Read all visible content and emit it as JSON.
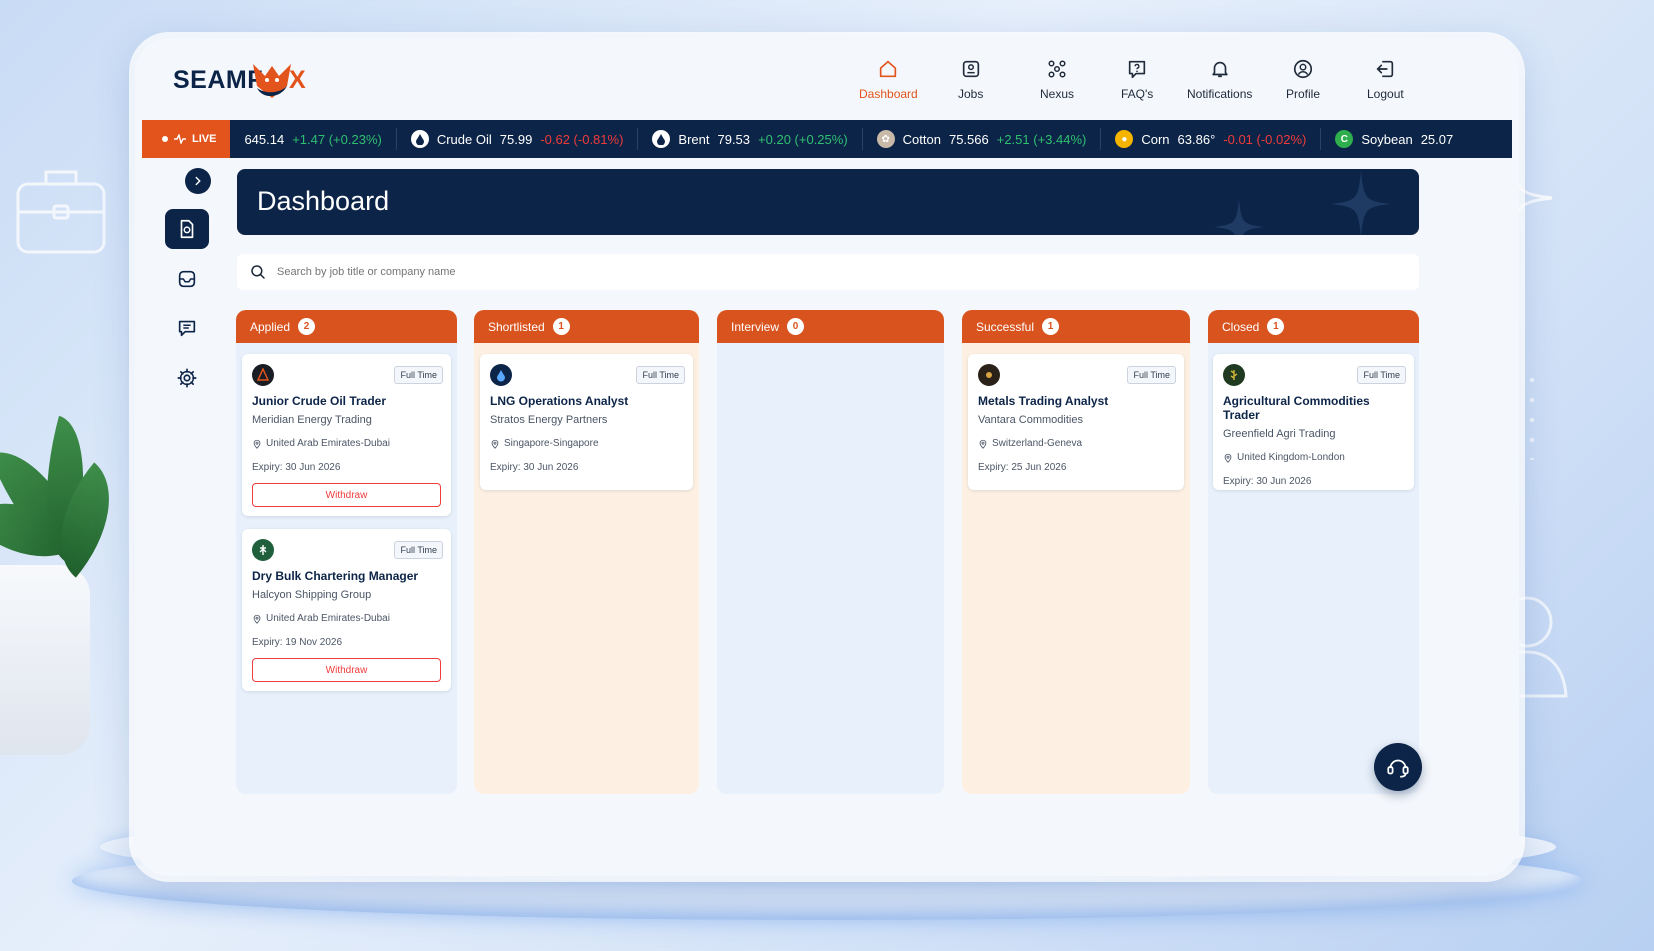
{
  "app": {
    "logo_left": "SEAMF",
    "logo_right": "X"
  },
  "nav": [
    {
      "label": "Dashboard",
      "icon": "home-icon",
      "active": true
    },
    {
      "label": "Jobs",
      "icon": "jobs-icon"
    },
    {
      "label": "Nexus",
      "icon": "network-icon"
    },
    {
      "label": "FAQ's",
      "icon": "faq-icon"
    },
    {
      "label": "Notifications",
      "icon": "bell-icon"
    },
    {
      "label": "Profile",
      "icon": "profile-icon"
    },
    {
      "label": "Logout",
      "icon": "logout-icon"
    }
  ],
  "ticker": {
    "live_label": "LIVE",
    "items": [
      {
        "name": "",
        "price": "645.14",
        "change": "+1.47 (+0.23%)",
        "direction": "up"
      },
      {
        "name": "Crude Oil",
        "price": "75.99",
        "change": "-0.62 (-0.81%)",
        "direction": "down",
        "icon": "oil-drop-icon"
      },
      {
        "name": "Brent",
        "price": "79.53",
        "change": "+0.20 (+0.25%)",
        "direction": "up",
        "icon": "oil-drop-icon"
      },
      {
        "name": "Cotton",
        "price": "75.566",
        "change": "+2.51 (+3.44%)",
        "direction": "up",
        "icon": "cotton-icon"
      },
      {
        "name": "Corn",
        "price": "63.86°",
        "change": "-0.01 (-0.02%)",
        "direction": "down",
        "icon": "corn-icon"
      },
      {
        "name": "Soybean",
        "price": "25.07",
        "change": "",
        "direction": "up",
        "icon": "soybean-icon"
      }
    ]
  },
  "page": {
    "title": "Dashboard"
  },
  "search": {
    "placeholder": "Search by job title or company name"
  },
  "columns": [
    {
      "label": "Applied",
      "count": "2",
      "cards": [
        {
          "title": "Junior Crude Oil Trader",
          "company": "Meridian Energy Trading",
          "location": "United Arab Emirates-Dubai",
          "expiry": "Expiry: 30 Jun 2026",
          "type": "Full Time",
          "action": "Withdraw"
        },
        {
          "title": "Dry Bulk Chartering Manager",
          "company": "Halcyon Shipping Group",
          "location": "United Arab Emirates-Dubai",
          "expiry": "Expiry: 19 Nov 2026",
          "type": "Full Time",
          "action": "Withdraw"
        }
      ]
    },
    {
      "label": "Shortlisted",
      "count": "1",
      "cards": [
        {
          "title": "LNG Operations Analyst",
          "company": "Stratos Energy Partners",
          "location": "Singapore-Singapore",
          "expiry": "Expiry: 30 Jun 2026",
          "type": "Full Time"
        }
      ]
    },
    {
      "label": "Interview",
      "count": "0",
      "cards": []
    },
    {
      "label": "Successful",
      "count": "1",
      "cards": [
        {
          "title": "Metals Trading Analyst",
          "company": "Vantara Commodities",
          "location": "Switzerland-Geneva",
          "expiry": "Expiry: 25 Jun 2026",
          "type": "Full Time"
        }
      ]
    },
    {
      "label": "Closed",
      "count": "1",
      "cards": [
        {
          "title": "Agricultural Commodities Trader",
          "company": "Greenfield Agri Trading",
          "location": "United Kingdom-London",
          "expiry": "Expiry: 30 Jun 2026",
          "type": "Full Time"
        }
      ]
    }
  ],
  "colors": {
    "brand_navy": "#0c2447",
    "brand_orange": "#d9531e",
    "up": "#2fbf71",
    "down": "#ef3b3b"
  }
}
